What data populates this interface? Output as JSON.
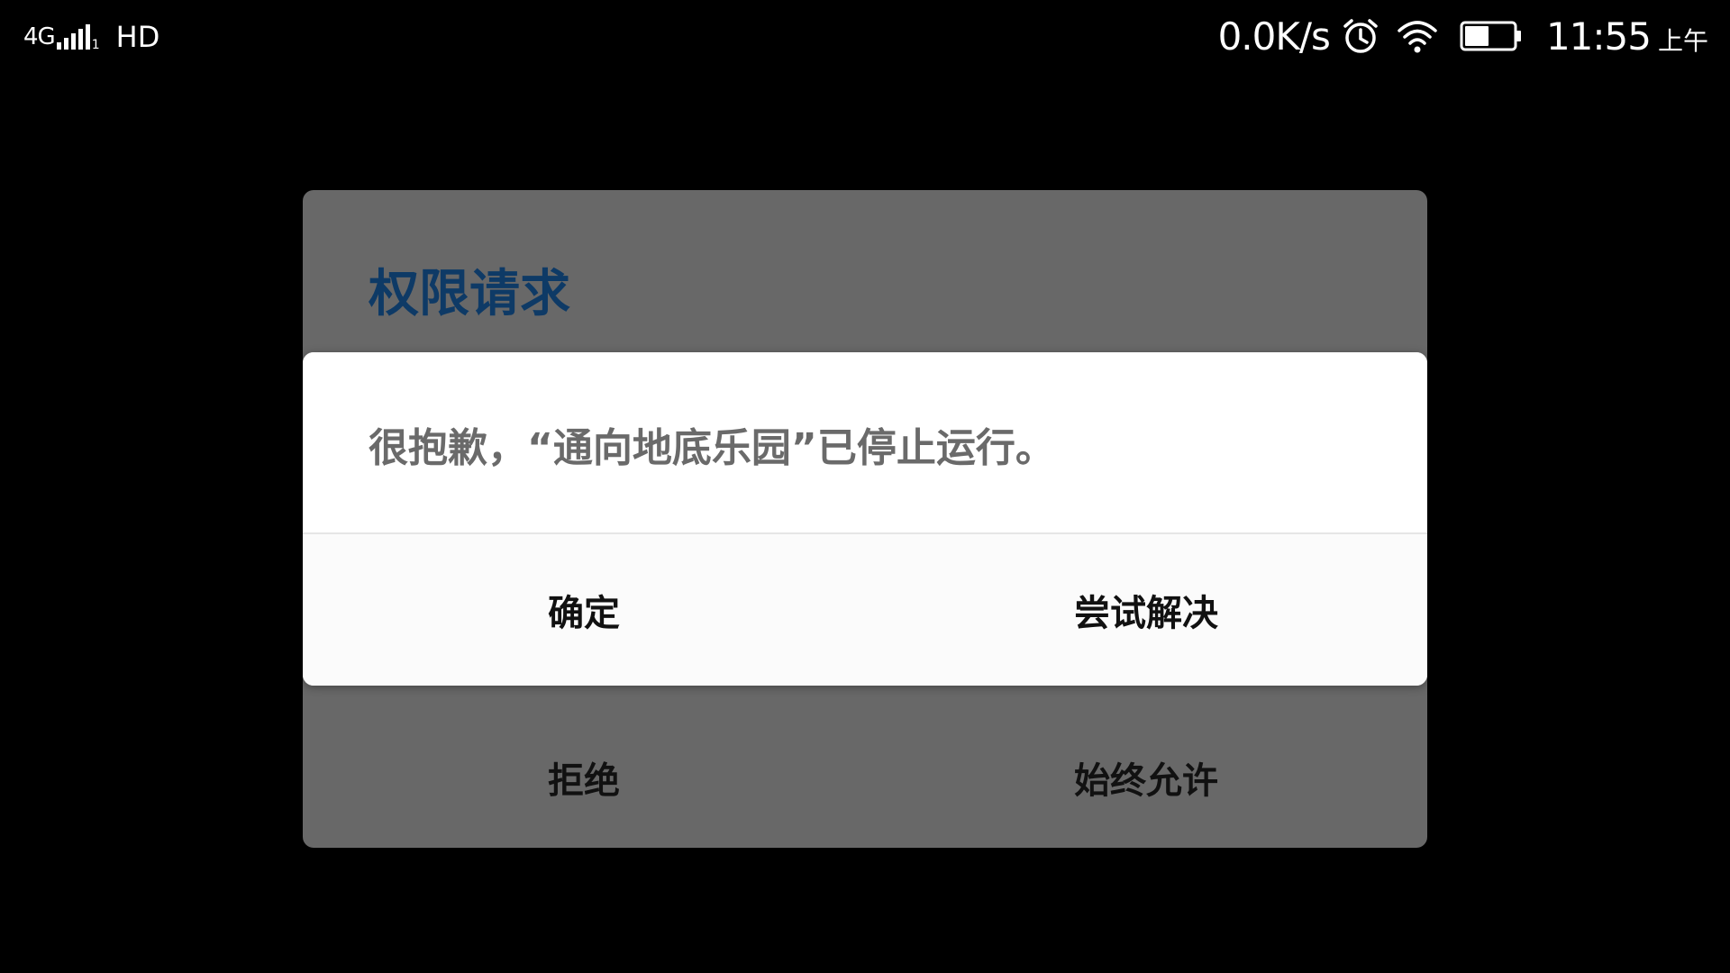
{
  "status_bar": {
    "network_type": "4G",
    "signal_sub": "1",
    "hd_label": "HD",
    "net_speed": "0.0K/s",
    "icons": [
      "signal-icon",
      "alarm-icon",
      "wifi-icon",
      "battery-icon"
    ],
    "battery_level": 0.5,
    "time": "11:55",
    "ampm": "上午"
  },
  "permission_dialog": {
    "title": "权限请求",
    "deny_label": "拒绝",
    "always_allow_label": "始终允许",
    "title_color": "#0e3a66",
    "background_color": "#686868"
  },
  "crash_dialog": {
    "message": "很抱歉，“通向地底乐园”已停止运行。",
    "ok_label": "确定",
    "try_fix_label": "尝试解决",
    "background_color": "#ffffff"
  }
}
